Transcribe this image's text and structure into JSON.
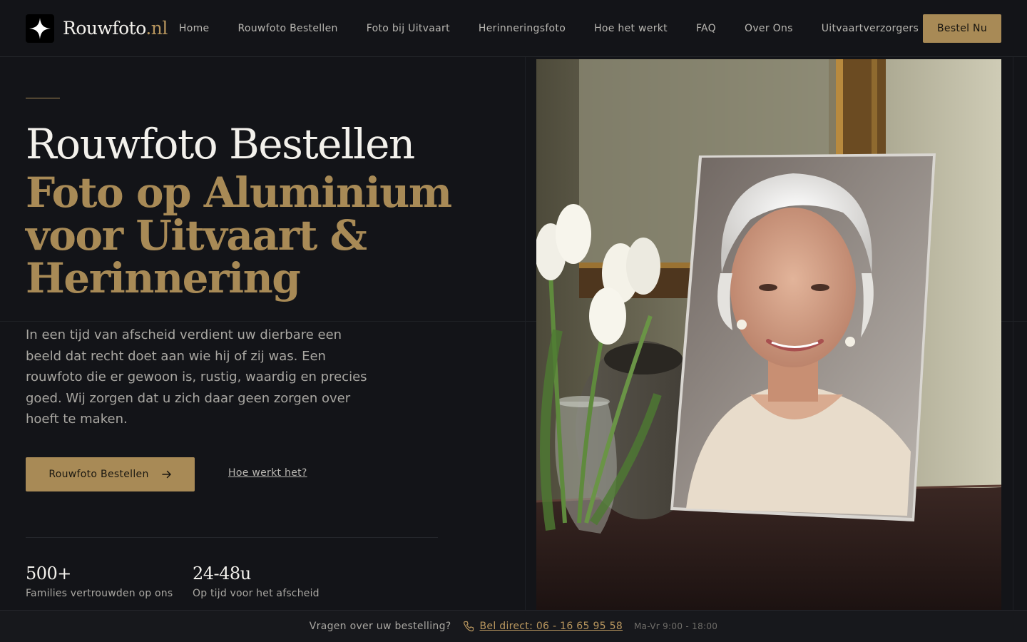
{
  "header": {
    "logo_name": "Rouwfoto",
    "logo_tld": ".nl",
    "nav": [
      {
        "label": "Home"
      },
      {
        "label": "Rouwfoto Bestellen"
      },
      {
        "label": "Foto bij Uitvaart"
      },
      {
        "label": "Herinneringsfoto"
      },
      {
        "label": "Hoe het werkt"
      },
      {
        "label": "FAQ"
      },
      {
        "label": "Over Ons"
      },
      {
        "label": "Uitvaartverzorgers"
      }
    ],
    "cta_label": "Bestel Nu"
  },
  "hero": {
    "title": "Rouwfoto Bestellen",
    "subtitle": "Foto op Aluminium voor Uitvaart & Herinnering",
    "intro": "In een tijd van afscheid verdient uw dierbare een beeld dat recht doet aan wie hij of zij was. Een rouwfoto die er gewoon is, rustig, waardig en precies goed. Wij zorgen dat u zich daar geen zorgen over hoeft te maken.",
    "primary_button": "Rouwfoto Bestellen",
    "secondary_link": "Hoe werkt het?",
    "stats": [
      {
        "value": "500+",
        "label": "Families vertrouwden op ons"
      },
      {
        "value": "24-48u",
        "label": "Op tijd voor het afscheid"
      }
    ]
  },
  "footer": {
    "question": "Vragen over uw bestelling?",
    "phone": "Bel direct: 06 - 16 65 95 58",
    "hours": "Ma-Vr 9:00 - 18:00"
  },
  "colors": {
    "background": "#131418",
    "accent": "#a88a56",
    "text": "#f3f1ec",
    "muted": "#a9a7a2"
  },
  "icons": {
    "logo": "sparkle-icon",
    "button_arrow": "arrow-right-icon",
    "phone": "phone-icon"
  }
}
